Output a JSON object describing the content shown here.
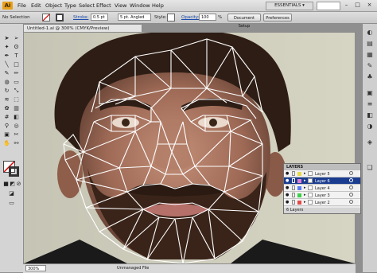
{
  "app": {
    "logo": "Ai"
  },
  "menu": [
    "File",
    "Edit",
    "Object",
    "Type",
    "Select",
    "Effect",
    "View",
    "Window",
    "Help"
  ],
  "workspace": {
    "label": "ESSENTIALS ▾"
  },
  "controlbar": {
    "selection": "No Selection",
    "stroke_label": "Stroke:",
    "stroke_value": "0.5 pt",
    "brush_value": "5 pt. Angled",
    "style_label": "Style:",
    "opacity_label": "Opacity:",
    "opacity_value": "100",
    "doc_setup": "Document Setup",
    "preferences": "Preferences"
  },
  "document": {
    "tab": "Untitled-1.ai @ 300% (CMYK/Preview)"
  },
  "status": {
    "zoom": "300%",
    "text": "Unmanaged File"
  },
  "layers": {
    "title": "LAYERS",
    "rows": [
      {
        "name": "Layer 5",
        "color": "#e8d84a",
        "selected": false
      },
      {
        "name": "Layer 6",
        "color": "#e27fd6",
        "selected": true
      },
      {
        "name": "Layer 4",
        "color": "#5a7cf0",
        "selected": false
      },
      {
        "name": "Layer 3",
        "color": "#3ccf4a",
        "selected": false
      },
      {
        "name": "Layer 2",
        "color": "#e24a4a",
        "selected": false
      }
    ],
    "footer": "6 Layers"
  },
  "colors": {
    "accent": "#1b3d8f",
    "mesh_line": "#ffffff",
    "app_orange": "#e8a01c"
  },
  "tools": [
    "selection-tool",
    "direct-selection-tool",
    "magic-wand-tool",
    "lasso-tool",
    "pen-tool",
    "type-tool",
    "line-tool",
    "rectangle-tool",
    "paintbrush-tool",
    "pencil-tool",
    "blob-brush-tool",
    "eraser-tool",
    "rotate-tool",
    "scale-tool",
    "warp-tool",
    "free-transform-tool",
    "symbol-sprayer-tool",
    "graph-tool",
    "mesh-tool",
    "gradient-tool",
    "eyedropper-tool",
    "blend-tool",
    "live-paint-tool",
    "slice-tool",
    "hand-tool",
    "zoom-tool"
  ],
  "dock": [
    "color-icon",
    "color-guide-icon",
    "swatches-icon",
    "brushes-icon",
    "symbols-icon",
    "graphic-styles-icon",
    "stroke-icon",
    "gradient-icon",
    "transparency-icon",
    "appearance-icon",
    "layers-icon"
  ]
}
